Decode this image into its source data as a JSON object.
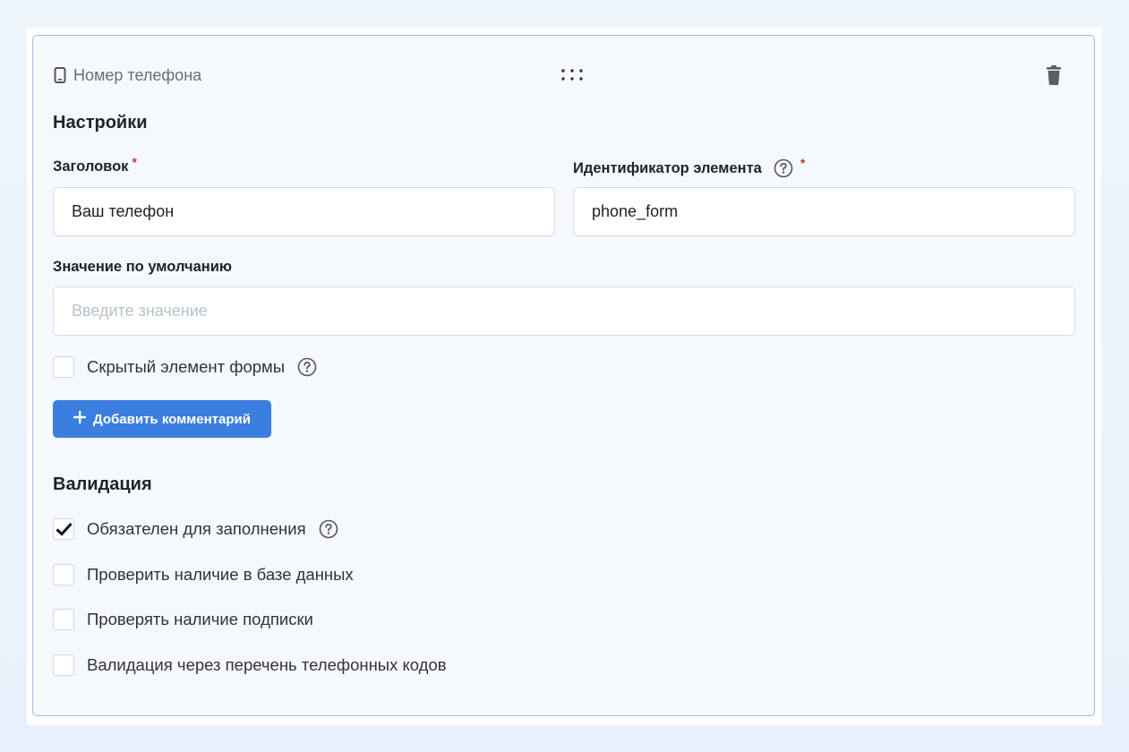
{
  "header": {
    "field_type_icon": "mobile-phone-icon",
    "field_type_label": "Номер телефона",
    "drag_icon": "drag-dots-icon",
    "delete_icon": "trash-icon"
  },
  "settings": {
    "title": "Настройки",
    "heading_label": "Заголовок",
    "heading_value": "Ваш телефон",
    "element_id_label": "Идентификатор элемента",
    "element_id_value": "phone_form",
    "default_value_label": "Значение по умолчанию",
    "default_value_placeholder": "Введите значение",
    "default_value": "",
    "required_mark": "*",
    "hidden_element_label": "Скрытый элемент формы",
    "hidden_element_checked": false,
    "add_comment_label": "Добавить комментарий",
    "add_comment_icon": "plus-icon"
  },
  "validation": {
    "title": "Валидация",
    "options": [
      {
        "label": "Обязателен для заполнения",
        "checked": true,
        "has_help": true
      },
      {
        "label": "Проверить наличие в базе данных",
        "checked": false,
        "has_help": false
      },
      {
        "label": "Проверять наличие подписки",
        "checked": false,
        "has_help": false
      },
      {
        "label": "Валидация через перечень телефонных кодов",
        "checked": false,
        "has_help": false
      }
    ]
  },
  "colors": {
    "accent": "#3a7fe0",
    "required": "#c0392b",
    "card_border": "#9dbde3"
  }
}
